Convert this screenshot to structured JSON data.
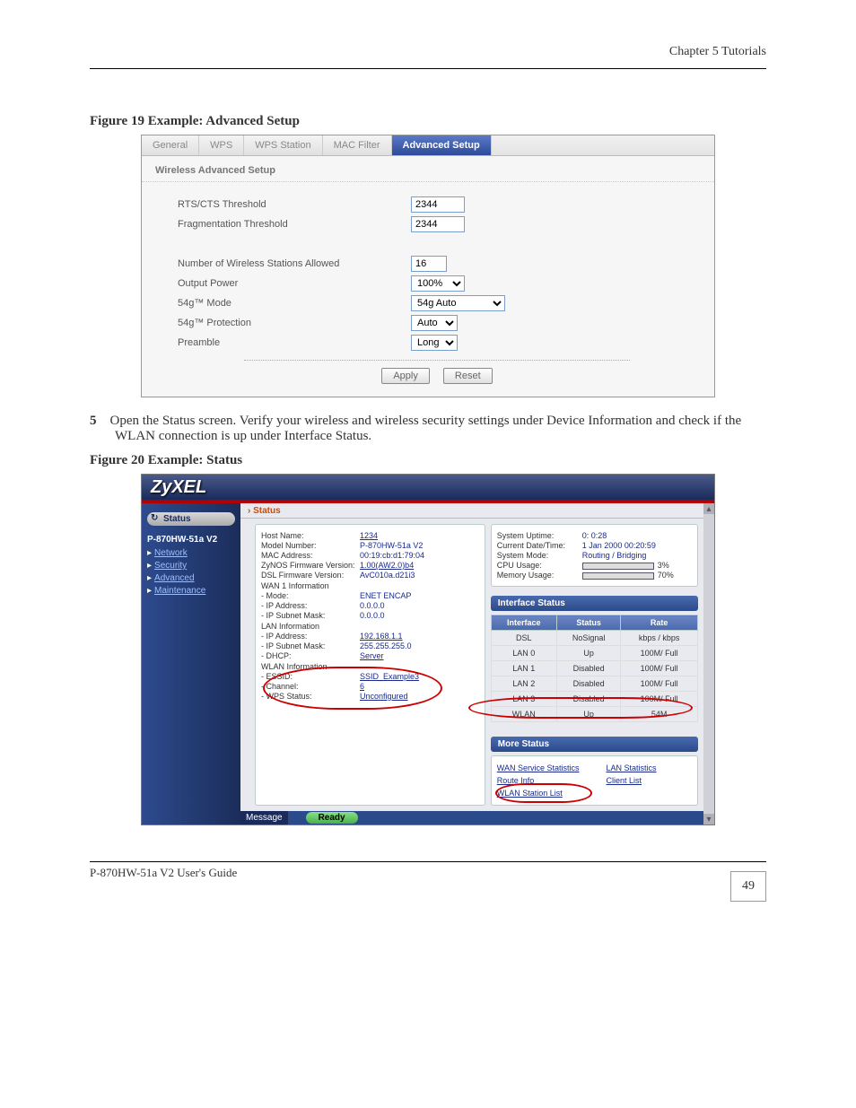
{
  "page": {
    "header_chapter": " Chapter 5 Tutorials",
    "footer_left": "P-870HW-51a V2 User's Guide",
    "page_number": "49",
    "fig1": "Figure 19   Example: Advanced Setup",
    "body1": "Open the Status screen. Verify your wireless and wireless security settings under Device Information and check if the WLAN connection is up under Interface Status.",
    "fig2": "Figure 20   Example: Status"
  },
  "scr1": {
    "tabs": [
      "General",
      "WPS",
      "WPS Station",
      "MAC Filter",
      "Advanced Setup"
    ],
    "section": "Wireless Advanced Setup",
    "fields": {
      "rts": {
        "label": "RTS/CTS Threshold",
        "value": "2344"
      },
      "frag": {
        "label": "Fragmentation Threshold",
        "value": "2344"
      },
      "nstations": {
        "label": "Number of Wireless Stations Allowed",
        "value": "16"
      },
      "power": {
        "label": "Output Power",
        "value": "100%"
      },
      "mode": {
        "label": "54g™ Mode",
        "value": "54g Auto"
      },
      "prot": {
        "label": "54g™ Protection",
        "value": "Auto"
      },
      "preamble": {
        "label": "Preamble",
        "value": "Long"
      }
    },
    "buttons": {
      "apply": "Apply",
      "reset": "Reset"
    }
  },
  "scr2": {
    "brand": "ZyXEL",
    "status_hdr": "Status",
    "sidebar": {
      "status": "Status",
      "model": "P-870HW-51a V2",
      "links": [
        "Network",
        "Security",
        "Advanced",
        "Maintenance"
      ]
    },
    "devinfo": {
      "host_name_label": "Host Name:",
      "host_name": "1234",
      "model_label": "Model Number:",
      "model": "P-870HW-51a V2",
      "mac_label": "MAC Address:",
      "mac": "00:19:cb:d1:79:04",
      "fw_label": "ZyNOS Firmware Version:",
      "fw": "1.00(AW2.0)b4",
      "dsl_label": "DSL Firmware Version:",
      "dsl": "AvC010a.d21i3",
      "wan_hdr": "WAN 1 Information",
      "wan_mode_label": " - Mode:",
      "wan_mode": "ENET ENCAP",
      "wan_ip_label": " - IP Address:",
      "wan_ip": "0.0.0.0",
      "wan_mask_label": " - IP Subnet Mask:",
      "wan_mask": "0.0.0.0",
      "lan_hdr": "LAN Information",
      "lan_ip_label": " - IP Address:",
      "lan_ip": "192.168.1.1",
      "lan_mask_label": " - IP Subnet Mask:",
      "lan_mask": "255.255.255.0",
      "lan_dhcp_label": " - DHCP:",
      "lan_dhcp": "Server",
      "wlan_hdr": "WLAN Information",
      "wlan_ssid_label": " - ESSID:",
      "wlan_ssid": "SSID_Example3",
      "wlan_ch_label": " - Channel:",
      "wlan_ch": "6",
      "wlan_wps_label": " - WPS Status:",
      "wlan_wps": "Unconfigured"
    },
    "sysstatus": {
      "uptime_label": "System Uptime:",
      "uptime": "0: 0:28",
      "date_label": "Current Date/Time:",
      "date": "1 Jan 2000 00:20:59",
      "mode_label": "System Mode:",
      "mode": "Routing / Bridging",
      "cpu_label": "CPU Usage:",
      "cpu_pct": "3%",
      "cpu_bar": 3,
      "mem_label": "Memory Usage:",
      "mem_pct": "70%",
      "mem_bar": 70
    },
    "iface_title": "Interface Status",
    "iface_headers": [
      "Interface",
      "Status",
      "Rate"
    ],
    "iface_rows": [
      [
        "DSL",
        "NoSignal",
        "kbps / kbps"
      ],
      [
        "LAN 0",
        "Up",
        "100M/ Full"
      ],
      [
        "LAN 1",
        "Disabled",
        "100M/ Full"
      ],
      [
        "LAN 2",
        "Disabled",
        "100M/ Full"
      ],
      [
        "LAN 3",
        "Disabled",
        "100M/ Full"
      ],
      [
        "WLAN",
        "Up",
        "54M"
      ]
    ],
    "more_title": "More Status",
    "more_links_left": [
      "WAN Service Statistics",
      "Route Info",
      "WLAN Station List"
    ],
    "more_links_right": [
      "LAN Statistics",
      "Client List"
    ],
    "msg_label": "Message",
    "msg_ready": "Ready"
  }
}
